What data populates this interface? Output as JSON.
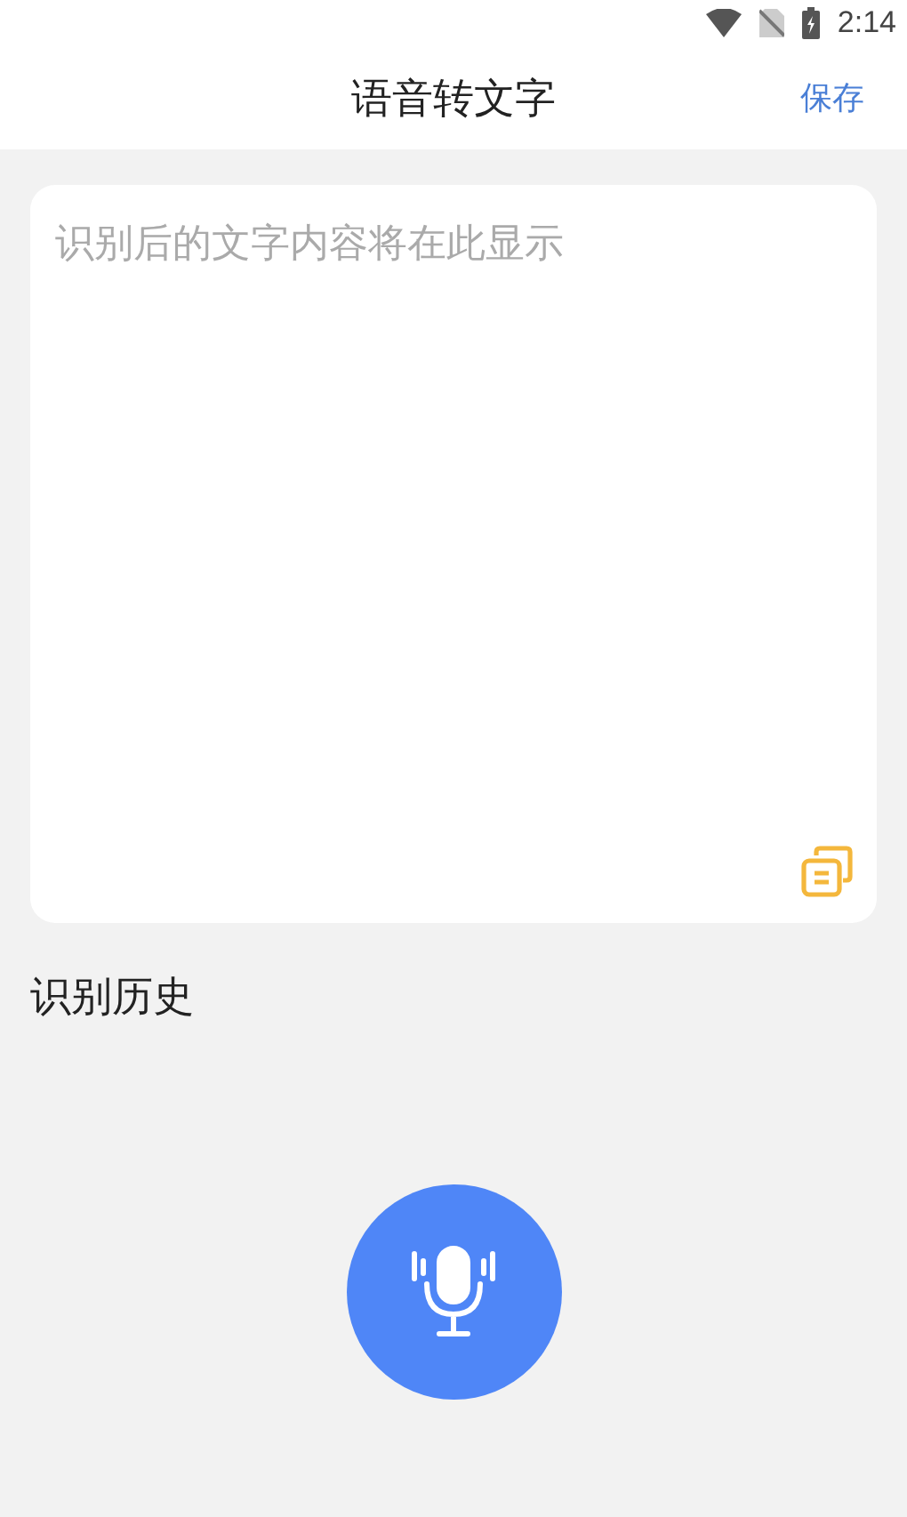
{
  "status_bar": {
    "time": "2:14"
  },
  "header": {
    "title": "语音转文字",
    "action": "保存"
  },
  "result": {
    "placeholder": "识别后的文字内容将在此显示"
  },
  "history": {
    "title": "识别历史"
  }
}
